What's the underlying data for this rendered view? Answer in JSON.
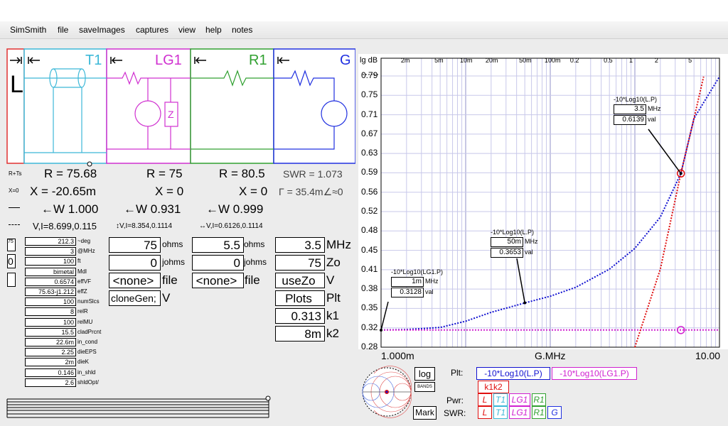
{
  "menu": [
    "SimSmith",
    "file",
    "saveImages",
    "captures",
    "view",
    "help",
    "notes"
  ],
  "components": {
    "load": {
      "label": "L",
      "color": "#e03030"
    },
    "t1": {
      "label": "T1",
      "color": "#3cb8d8",
      "R": "R = 75.68",
      "X": "X = -20.65m",
      "W": "←W 1.000",
      "VI": "V,I=8.699,0.115"
    },
    "lg1": {
      "label": "LG1",
      "color": "#d030d0",
      "R": "R = 75",
      "X": "X = 0",
      "W": "←W 0.931",
      "VI": "↕V,I=8.354,0.1114"
    },
    "r1": {
      "label": "R1",
      "color": "#30a030",
      "R": "R = 80.5",
      "X": "X = 0",
      "W": "←W 0.999",
      "VI": "↔V,I=0.6126,0.1114"
    },
    "g": {
      "label": "G",
      "color": "#2030e0",
      "swr": "SWR = 1.073",
      "gamma": "Γ = 35.4m∠≈0"
    }
  },
  "side_icons": {
    "rx": "R+Ts",
    "x0": "X=0",
    "t75": "75",
    "t0": "0"
  },
  "t1_params": [
    {
      "value": "212.3",
      "label": "~deg"
    },
    {
      "value": "3",
      "label": "@MHz"
    },
    {
      "value": "100",
      "label": "ft"
    },
    {
      "value": "bimetal",
      "label": "Mdl"
    },
    {
      "value": "0.6574",
      "label": "effVF"
    },
    {
      "value": "75.63-j1.212",
      "label": "effZ"
    },
    {
      "value": "100",
      "label": "numSlcs"
    },
    {
      "value": "8",
      "label": "relR"
    },
    {
      "value": "100",
      "label": "relMU"
    },
    {
      "value": "15.5",
      "label": "cladPrcnt"
    },
    {
      "value": "22.6m",
      "label": "in_cond"
    },
    {
      "value": "2.25",
      "label": "dieEPS"
    },
    {
      "value": "2m",
      "label": "dieK"
    },
    {
      "value": "0.146",
      "label": "in_shld"
    },
    {
      "value": "2.6",
      "label": "shldOpt/"
    }
  ],
  "lg1_params": [
    {
      "value": "75",
      "unit": "ohms"
    },
    {
      "value": "0",
      "unit": "johms"
    },
    {
      "value": "<none>",
      "unit": "file"
    },
    {
      "value": "cloneGen;",
      "unit": "V"
    }
  ],
  "r1_params": [
    {
      "value": "5.5",
      "unit": "ohms"
    },
    {
      "value": "0",
      "unit": "johms"
    },
    {
      "value": "<none>",
      "unit": "file"
    }
  ],
  "g_params": [
    {
      "value": "3.5",
      "unit": "MHz"
    },
    {
      "value": "75",
      "unit": "Zo"
    },
    {
      "value": "useZo",
      "unit": "V"
    },
    {
      "value": "Plots",
      "unit": "Plt"
    },
    {
      "value": "0.313",
      "unit": "k1"
    },
    {
      "value": "8m",
      "unit": "k2"
    }
  ],
  "plot": {
    "y_title": "lg dB",
    "x_axis_label": "G.MHz",
    "x_min_label": "1.000m",
    "x_max_label": "10.00",
    "y_ticks": [
      "0.79",
      "0.75",
      "0.71",
      "0.67",
      "0.63",
      "0.59",
      "0.56",
      "0.52",
      "0.48",
      "0.45",
      "0.41",
      "0.38",
      "0.35",
      "0.32",
      "0.28"
    ],
    "top_ticks": [
      "2m",
      "5m",
      "10m",
      "20m",
      "50m",
      "100m",
      "0.2",
      "0.5",
      "1",
      "2",
      "5"
    ],
    "colors": {
      "lp": "#1010d0",
      "lg1p": "#d020d0",
      "red": "#e01010"
    }
  },
  "chart_data": {
    "type": "line",
    "xlabel": "G.MHz",
    "ylabel": "lg dB",
    "x_scale": "log",
    "xlim": [
      0.001,
      10
    ],
    "ylim": [
      0.28,
      0.8
    ],
    "grid": true,
    "series": [
      {
        "name": "-10*Log10(L.P)",
        "color": "#1010d0",
        "x": [
          0.001,
          0.002,
          0.005,
          0.01,
          0.02,
          0.05,
          0.1,
          0.2,
          0.5,
          1,
          2,
          3.5,
          5,
          10
        ],
        "y": [
          0.313,
          0.314,
          0.318,
          0.33,
          0.347,
          0.365,
          0.378,
          0.395,
          0.43,
          0.47,
          0.53,
          0.614,
          0.72,
          0.8
        ]
      },
      {
        "name": "-10*Log10(LG1.P)",
        "color": "#d020d0",
        "x": [
          0.001,
          10
        ],
        "y": [
          0.313,
          0.313
        ]
      },
      {
        "name": "",
        "color": "#e01010",
        "x": [
          1.0,
          2.0,
          3.5,
          5.0,
          6.5
        ],
        "y": [
          0.28,
          0.43,
          0.614,
          0.72,
          0.8
        ]
      }
    ],
    "markers": [
      {
        "title": "-10*Log10(LG1.P)",
        "freq": "1m",
        "freq_unit": "MHz",
        "value": "0.3128",
        "value_unit": "val",
        "x": 0.001,
        "y": 0.3128
      },
      {
        "title": "-10*Log10(L.P)",
        "freq": "50m",
        "freq_unit": "MHz",
        "value": "0.3653",
        "value_unit": "val",
        "x": 0.05,
        "y": 0.3653
      },
      {
        "title": "-10*Log10(L.P)",
        "freq": "3.5",
        "freq_unit": "MHz",
        "value": "0.6139",
        "value_unit": "val",
        "x": 3.5,
        "y": 0.6139
      }
    ]
  },
  "controls": {
    "log": "log",
    "bands": "BANDS",
    "mark": "Mark",
    "plt_label": "Plt:",
    "plt1": "-10*Log10(L.P)",
    "plt2": "-10*Log10(LG1.P)",
    "k1k2": "k1k2",
    "pwr_label": "Pwr:",
    "swr_label": "SWR:",
    "pwr_buttons": [
      "L",
      "T1",
      "LG1",
      "R1"
    ],
    "swr_buttons": [
      "L",
      "T1",
      "LG1",
      "R1",
      "G"
    ]
  }
}
